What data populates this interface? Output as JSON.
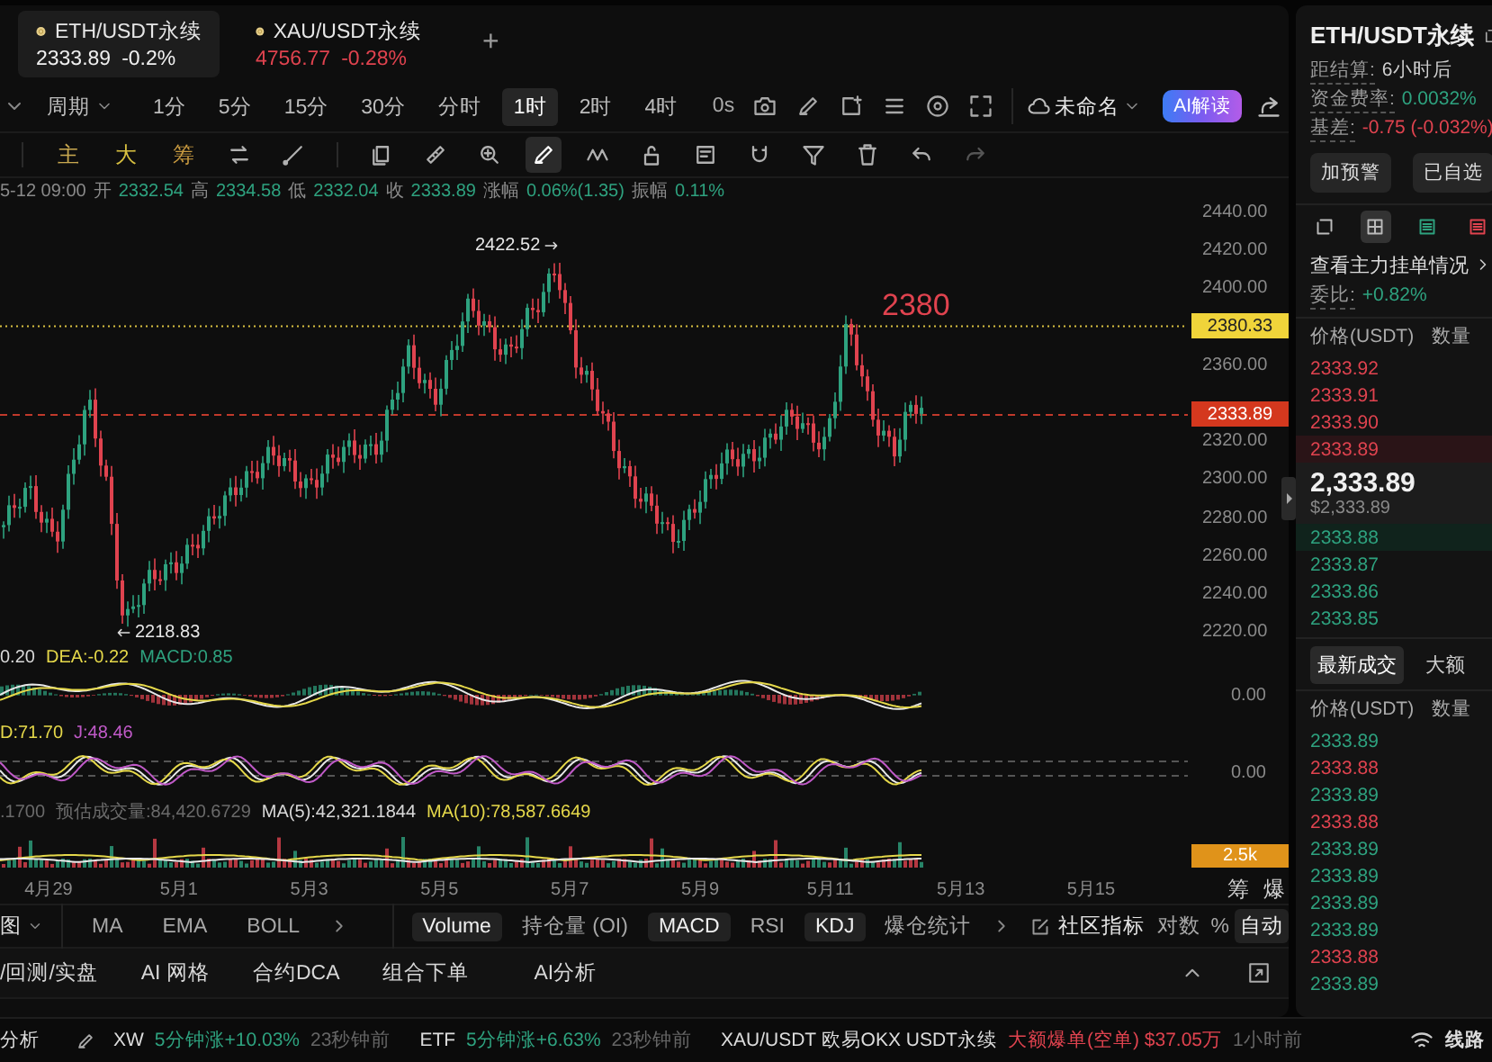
{
  "symbol_tabs": [
    {
      "name": "ETH/USDT永续",
      "price": "2333.89",
      "change": "-0.2%",
      "selected": true
    },
    {
      "name": "XAU/USDT永续",
      "price": "4756.77",
      "change": "-0.28%",
      "selected": false
    }
  ],
  "add_tab": "+",
  "toolbar": {
    "period_label": "周期",
    "intervals": [
      {
        "label": "1分",
        "selected": false
      },
      {
        "label": "5分",
        "selected": false
      },
      {
        "label": "15分",
        "selected": false
      },
      {
        "label": "30分",
        "selected": false
      },
      {
        "label": "分时",
        "selected": false
      },
      {
        "label": "1时",
        "selected": true
      },
      {
        "label": "2时",
        "selected": false
      },
      {
        "label": "4时",
        "selected": false
      }
    ],
    "refresh": "0s",
    "layout_name": "未命名",
    "ai_button": "AI解读"
  },
  "drawing_toolbar": {
    "shortcuts": [
      "主",
      "大",
      "筹"
    ],
    "tools": [
      {
        "kind": "swap",
        "selected": false
      },
      {
        "kind": "line",
        "selected": false
      },
      {
        "kind": "copy",
        "selected": false
      },
      {
        "kind": "ruler",
        "selected": false
      },
      {
        "kind": "zoom",
        "selected": false
      },
      {
        "kind": "pen",
        "selected": true
      },
      {
        "kind": "pattern",
        "selected": false
      },
      {
        "kind": "lock",
        "selected": false
      },
      {
        "kind": "note",
        "selected": false
      },
      {
        "kind": "magnet",
        "selected": false
      },
      {
        "kind": "filter",
        "selected": false
      },
      {
        "kind": "trash",
        "selected": false
      },
      {
        "kind": "undo",
        "selected": false
      },
      {
        "kind": "redo",
        "selected": false
      }
    ]
  },
  "chart": {
    "ohlc": {
      "time": "5-12 09:00",
      "fields": [
        {
          "label": "开",
          "value": "2332.54"
        },
        {
          "label": "高",
          "value": "2334.58"
        },
        {
          "label": "低",
          "value": "2332.04"
        },
        {
          "label": "收",
          "value": "2333.89"
        },
        {
          "label": "涨幅",
          "value": "0.06%(1.35)"
        },
        {
          "label": "振幅",
          "value": "0.11%"
        }
      ]
    },
    "price_axis": [
      "2440.00",
      "2420.00",
      "2400.00",
      "2360.00",
      "2320.00",
      "2300.00",
      "2280.00",
      "2260.00",
      "2240.00",
      "2220.00"
    ],
    "high_marker": "2422.52",
    "low_marker": "2218.83",
    "annotation": "2380",
    "alert_tag": "2380.33",
    "last_price_tag": "2333.89",
    "macd": {
      "values": [
        {
          "text": "0.20",
          "color": "#d8d8d8"
        },
        {
          "text": "DEA:-0.22",
          "color": "#e5d84a"
        },
        {
          "text": "MACD:0.85",
          "color": "#2ea27f"
        }
      ],
      "axis": "0.00"
    },
    "kdj": {
      "values": [
        {
          "text": "D:71.70",
          "color": "#e5d84a"
        },
        {
          "text": "J:48.46",
          "color": "#c05ac8"
        }
      ],
      "axis": "0.00"
    },
    "volume": {
      "values": [
        {
          "text": ".1700",
          "color": "#6a6a6a"
        },
        {
          "text": "预估成交量:84,420.6729",
          "color": "#6a6a6a"
        },
        {
          "text": "MA(5):42,321.1844",
          "color": "#d8d8d8"
        },
        {
          "text": "MA(10):78,587.6649",
          "color": "#e5d84a"
        }
      ],
      "axis": "2.5k"
    },
    "dates": [
      "4月29",
      "5月1",
      "5月3",
      "5月5",
      "5月7",
      "5月9",
      "5月11",
      "5月13",
      "5月15"
    ],
    "corner_labels": [
      "筹",
      "爆"
    ]
  },
  "indicator_bar": {
    "menu": "图",
    "main": [
      {
        "label": "MA",
        "selected": false
      },
      {
        "label": "EMA",
        "selected": false
      },
      {
        "label": "BOLL",
        "selected": false
      }
    ],
    "sub": [
      {
        "label": "Volume",
        "selected": true
      },
      {
        "label": "持仓量 (OI)",
        "selected": false
      },
      {
        "label": "MACD",
        "selected": true
      },
      {
        "label": "RSI",
        "selected": false
      },
      {
        "label": "KDJ",
        "selected": true
      },
      {
        "label": "爆仓统计",
        "selected": false
      }
    ],
    "community": "社区指标",
    "options": [
      {
        "label": "对数",
        "selected": false
      },
      {
        "label": "%",
        "selected": false
      },
      {
        "label": "自动",
        "selected": true
      }
    ]
  },
  "bottom_tabs": [
    "/回测/实盘",
    "AI 网格",
    "合约DCA",
    "组合下单",
    "AI分析"
  ],
  "side_panel": {
    "title": "ETH/USDT永续",
    "stats": [
      {
        "label": "距结算:",
        "value": "6小时后",
        "color": "#cfcfcf"
      },
      {
        "label": "资金费率:",
        "value": "0.0032%",
        "color": "#2ea27f"
      },
      {
        "label": "基差:",
        "value": "-0.75 (-0.032%)",
        "color": "#e0434f"
      }
    ],
    "buttons": [
      "加预警",
      "已自选"
    ],
    "view_modes": [
      {
        "kind": "popout",
        "selected": false
      },
      {
        "kind": "both",
        "selected": true
      },
      {
        "kind": "bids",
        "selected": false
      },
      {
        "kind": "asks",
        "selected": false
      }
    ],
    "depth_link": "查看主力挂单情况",
    "ratio": {
      "label": "委比:",
      "value": "+0.82%"
    },
    "book_header": [
      "价格(USDT)",
      "数量"
    ],
    "asks": [
      "2333.92",
      "2333.91",
      "2333.90",
      "2333.89"
    ],
    "mid_price": "2,333.89",
    "mid_usd": "$2,333.89",
    "bids": [
      "2333.88",
      "2333.87",
      "2333.86",
      "2333.85"
    ],
    "trade_tabs": [
      {
        "label": "最新成交",
        "selected": true
      },
      {
        "label": "大额",
        "selected": false
      }
    ],
    "trade_header": [
      "价格(USDT)",
      "数量"
    ],
    "trades": [
      {
        "price": "2333.89",
        "color": "#2ea27f"
      },
      {
        "price": "2333.88",
        "color": "#e0434f"
      },
      {
        "price": "2333.89",
        "color": "#2ea27f"
      },
      {
        "price": "2333.88",
        "color": "#e0434f"
      },
      {
        "price": "2333.89",
        "color": "#2ea27f"
      },
      {
        "price": "2333.89",
        "color": "#2ea27f"
      },
      {
        "price": "2333.89",
        "color": "#2ea27f"
      },
      {
        "price": "2333.89",
        "color": "#2ea27f"
      },
      {
        "price": "2333.88",
        "color": "#e0434f"
      },
      {
        "price": "2333.89",
        "color": "#2ea27f"
      }
    ]
  },
  "ticker": {
    "label": "分析",
    "items": [
      {
        "symbol": "XW",
        "event": "5分钟涨+10.03%",
        "time": "23秒钟前",
        "kind": "rise"
      },
      {
        "symbol": "ETF",
        "event": "5分钟涨+6.63%",
        "time": "23秒钟前",
        "kind": "rise"
      },
      {
        "symbol": "XAU/USDT 欧易OKX USDT永续",
        "event": "大额爆单(空单) $37.05万",
        "time": "1小时前",
        "kind": "liquidation"
      }
    ],
    "network": "线路"
  }
}
